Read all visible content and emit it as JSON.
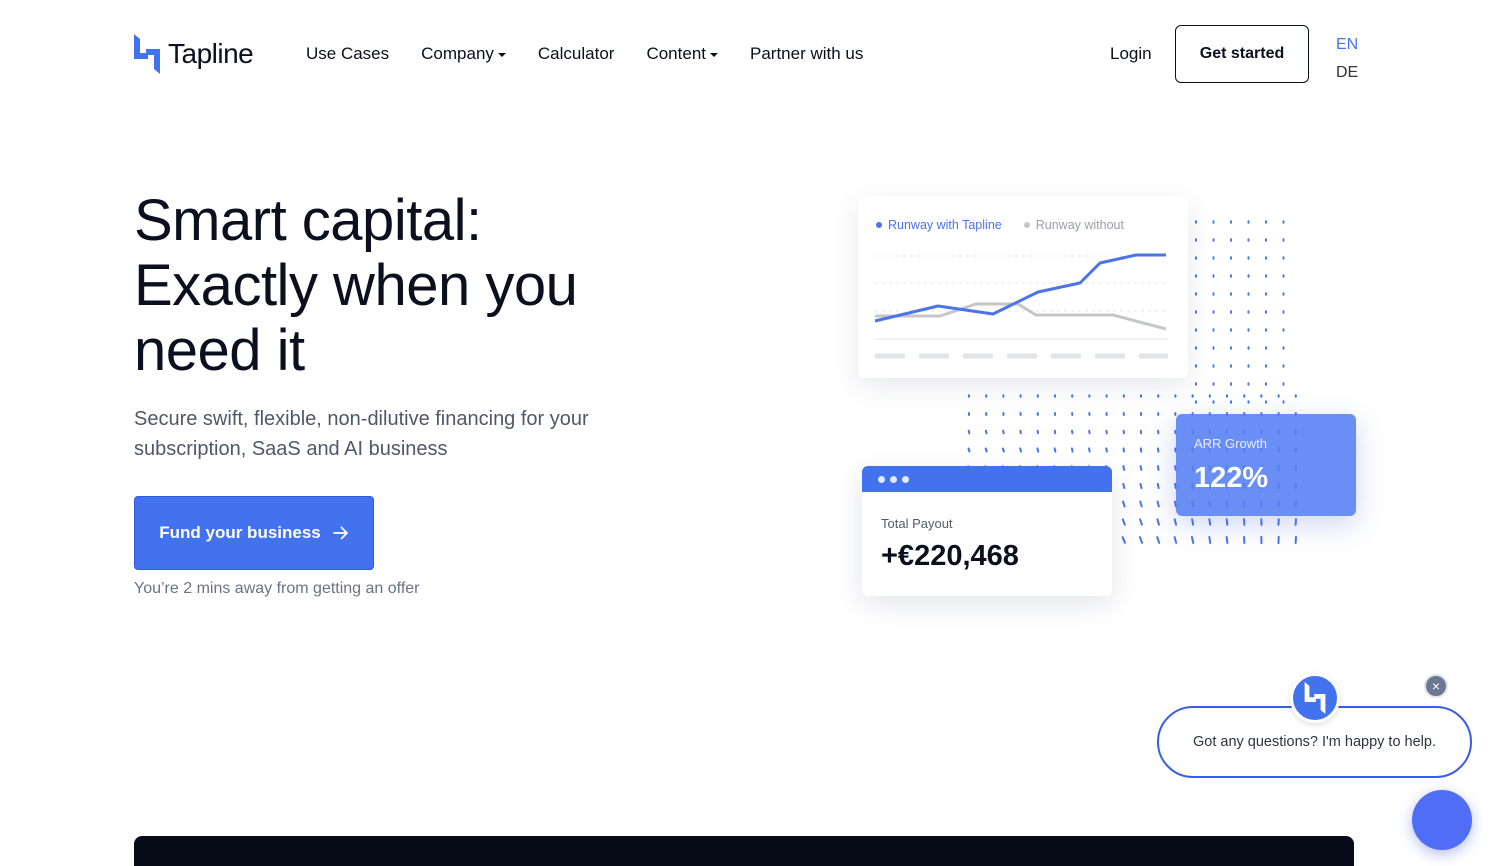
{
  "brand": {
    "name": "Tapline",
    "accent": "#4372ef"
  },
  "nav": {
    "items": [
      {
        "label": "Use Cases",
        "dropdown": false
      },
      {
        "label": "Company",
        "dropdown": true
      },
      {
        "label": "Calculator",
        "dropdown": false
      },
      {
        "label": "Content",
        "dropdown": true
      },
      {
        "label": "Partner with us",
        "dropdown": false
      }
    ],
    "login": "Login",
    "cta": "Get started",
    "languages": {
      "active": "EN",
      "other": "DE"
    }
  },
  "hero": {
    "title_lines": [
      "Smart capital:",
      "Exactly when you",
      "need it"
    ],
    "subtitle": "Secure swift, flexible, non-dilutive financing for your subscription, SaaS and AI business",
    "button": "Fund your business",
    "note": "You’re 2 mins away from getting an offer"
  },
  "illustration": {
    "chart": {
      "legend_a": "Runway with Tapline",
      "legend_b": "Runway without",
      "color_a": "#4a74e8",
      "color_b": "#c4c6ca"
    },
    "payout": {
      "label": "Total Payout",
      "value": "+€220,468"
    },
    "arr": {
      "label": "ARR Growth",
      "value": "122%"
    }
  },
  "chat": {
    "message": "Got any questions? I'm happy to help.",
    "close_symbol": "×"
  }
}
